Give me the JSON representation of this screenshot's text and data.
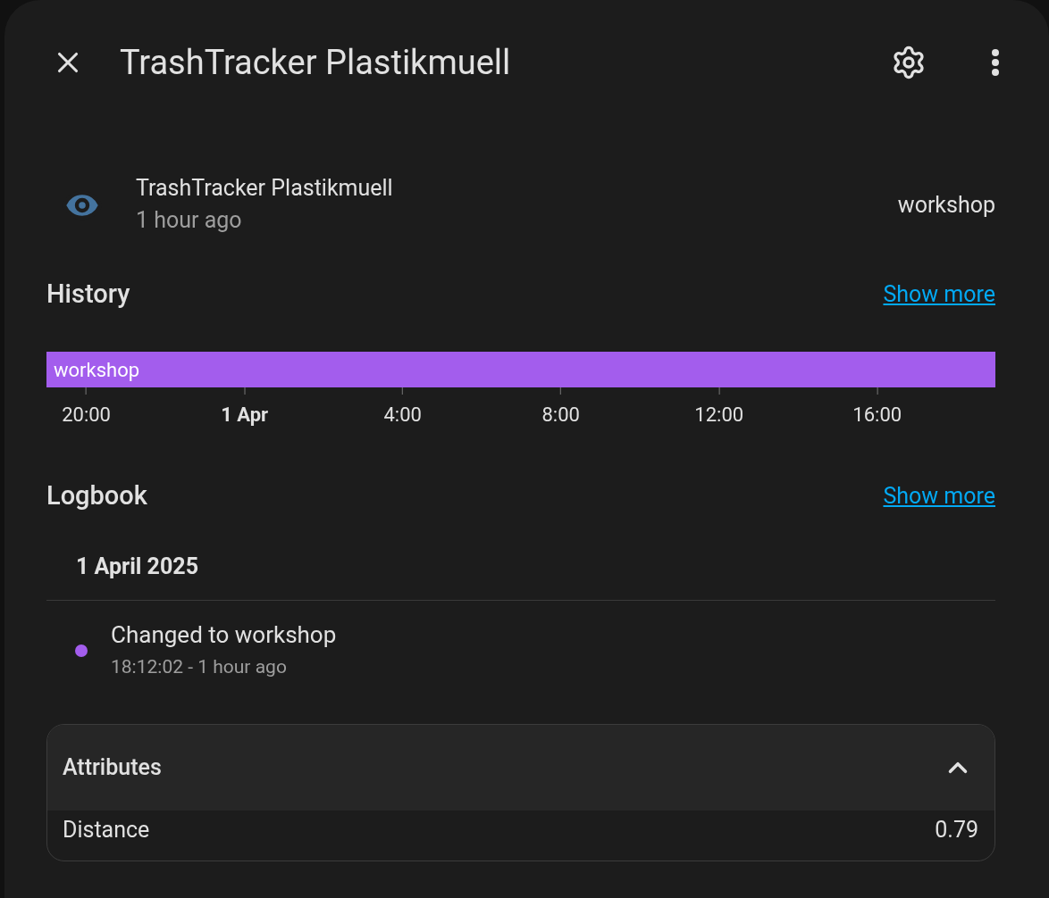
{
  "dialog": {
    "title": "TrashTracker Plastikmuell"
  },
  "entity": {
    "name": "TrashTracker Plastikmuell",
    "last_changed": "1 hour ago",
    "state": "workshop"
  },
  "history": {
    "title": "History",
    "link": "Show more",
    "bar": {
      "label": "workshop",
      "color": "#a35ded"
    },
    "ticks": [
      {
        "label": "20:00",
        "kind": "time"
      },
      {
        "label": "1 Apr",
        "kind": "date"
      },
      {
        "label": "4:00",
        "kind": "time"
      },
      {
        "label": "8:00",
        "kind": "time"
      },
      {
        "label": "12:00",
        "kind": "time"
      },
      {
        "label": "16:00",
        "kind": "time"
      }
    ]
  },
  "logbook": {
    "title": "Logbook",
    "link": "Show more",
    "date": "1 April 2025",
    "entries": [
      {
        "message": "Changed to workshop",
        "time": "18:12:02 - 1 hour ago",
        "color": "#a35ded"
      }
    ]
  },
  "attributes": {
    "title": "Attributes",
    "expanded": true,
    "rows": [
      {
        "name": "Distance",
        "value": "0.79"
      }
    ]
  }
}
